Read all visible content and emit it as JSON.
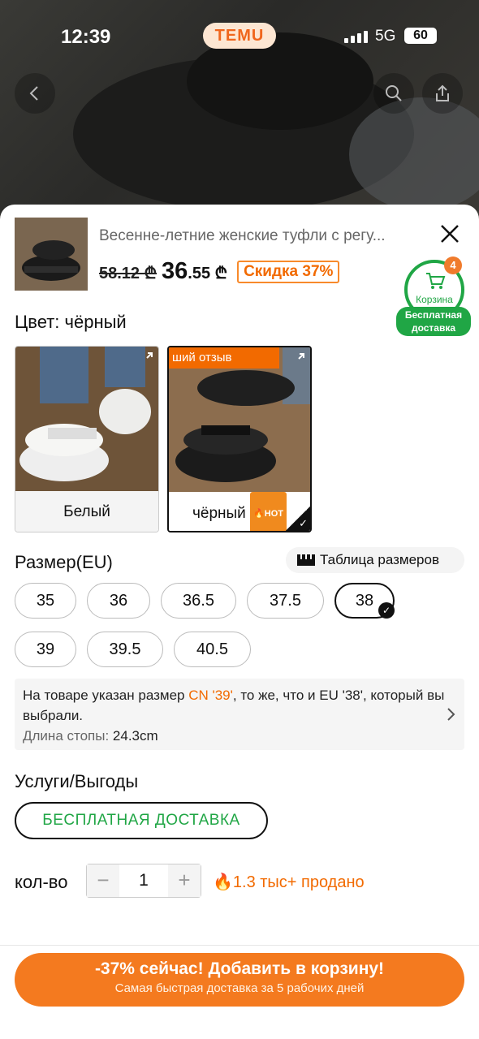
{
  "status": {
    "time": "12:39",
    "app_logo": "TEMU",
    "network": "5G",
    "battery": "60"
  },
  "product": {
    "title": "Весенне-летние женские туфли с регу...",
    "old_price": "58.12 ₾",
    "price_main": "36",
    "price_cents": ".55 ₾",
    "discount": "Скидка 37%"
  },
  "cart": {
    "label": "Корзина",
    "count": "4",
    "free_line1": "Бесплатная",
    "free_line2": "доставка"
  },
  "color": {
    "heading": "Цвет: чёрный",
    "options": [
      {
        "label": "Белый",
        "selected": false
      },
      {
        "label": "чёрный",
        "selected": true,
        "badge": "HOT",
        "tag": "ший отзыв"
      }
    ]
  },
  "size": {
    "heading": "Размер(EU)",
    "guide_label": "Таблица размеров",
    "options": [
      "35",
      "36",
      "36.5",
      "37.5",
      "38",
      "39",
      "39.5",
      "40.5"
    ],
    "selected": "38"
  },
  "size_info": {
    "text_before": "На товаре указан размер ",
    "highlight": "CN '39'",
    "text_after": ", то же, что и EU '38', который вы выбрали.",
    "foot_label": "Длина стопы: ",
    "foot_value": "24.3cm"
  },
  "services": {
    "heading": "Услуги/Выгоды",
    "free_shipping": "БЕСПЛАТНАЯ ДОСТАВКА"
  },
  "quantity": {
    "label": "кол-во",
    "value": "1",
    "minus": "−",
    "plus": "+",
    "sold": "1.3 тыс+ продано"
  },
  "cta": {
    "line1": "-37% сейчас! Добавить в корзину!",
    "line2": "Самая быстрая доставка за 5 рабочих дней"
  },
  "colors": {
    "accent": "#f47a1f",
    "green": "#20a645"
  }
}
